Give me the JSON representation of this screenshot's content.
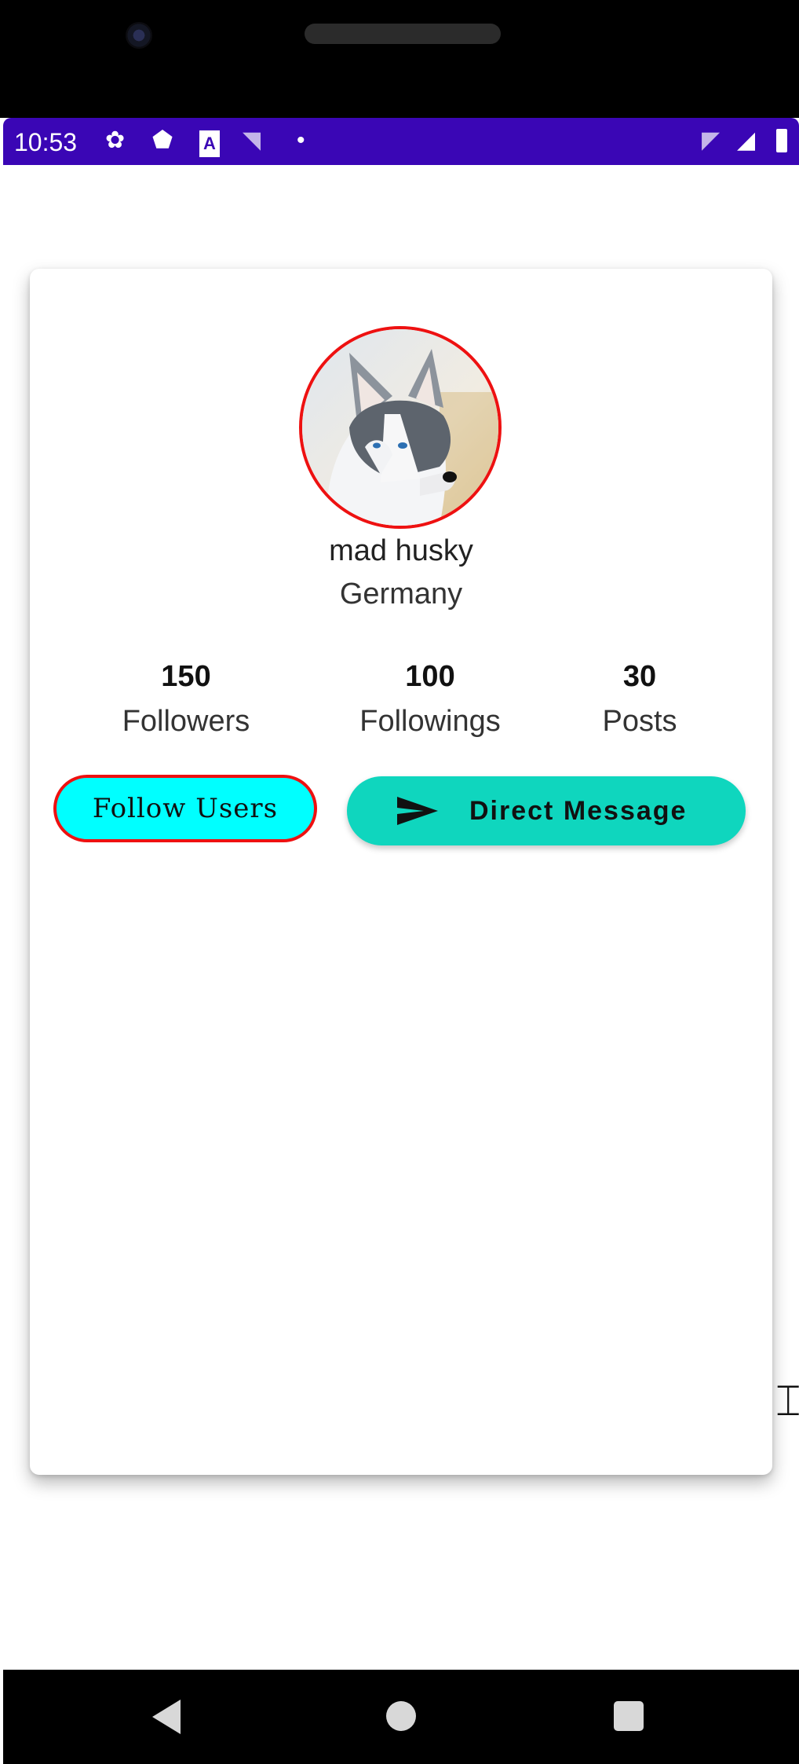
{
  "status_bar": {
    "time": "10:53",
    "icons": [
      "settings-icon",
      "shield-icon",
      "a-icon",
      "wifi-icon",
      "dot-icon",
      "wifi-x-icon",
      "signal-icon",
      "battery-icon"
    ]
  },
  "profile": {
    "name": "mad husky",
    "country": "Germany",
    "avatar_border_color": "#ee1111"
  },
  "stats": [
    {
      "value": "150",
      "label": "Followers"
    },
    {
      "value": "100",
      "label": "Followings"
    },
    {
      "value": "30",
      "label": "Posts"
    }
  ],
  "actions": {
    "follow_label": "Follow Users",
    "follow_bg": "#00ffff",
    "dm_label": "Direct Message",
    "dm_icon": "send-icon",
    "dm_bg": "#0fd6be"
  },
  "colors": {
    "status_bar": "#3a06b5"
  }
}
